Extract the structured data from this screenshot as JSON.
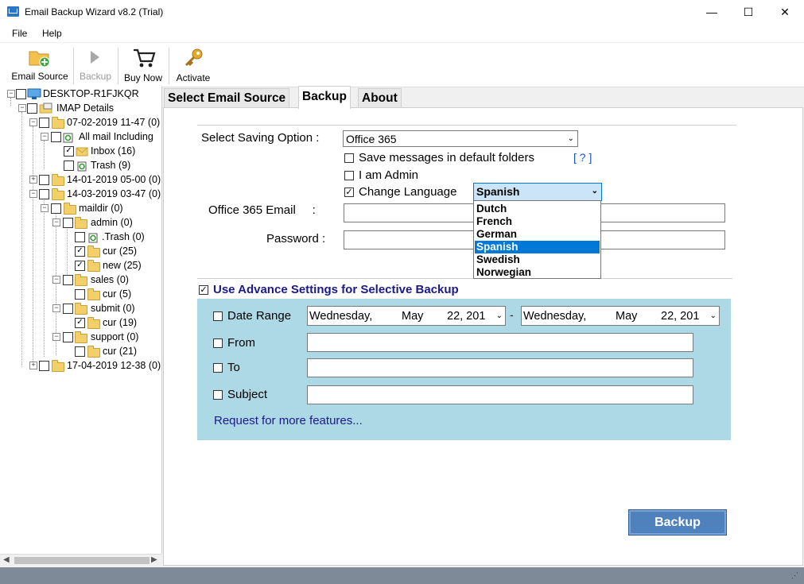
{
  "window": {
    "title": "Email Backup Wizard v8.2 (Trial)",
    "minimize": "—",
    "maximize": "☐",
    "close": "✕"
  },
  "menu": {
    "items": [
      "File",
      "Help"
    ]
  },
  "toolbar": {
    "email_source": "Email Source",
    "backup": "Backup",
    "buy_now": "Buy Now",
    "activate": "Activate"
  },
  "tree": {
    "root": "DESKTOP-R1FJKQR",
    "imap": "IMAP Details",
    "nodes": [
      "07-02-2019 11-47 (0)",
      "All mail Including",
      "Inbox (16)",
      "Trash (9)",
      "14-01-2019 05-00 (0)",
      "14-03-2019 03-47 (0)",
      "maildir (0)",
      "admin (0)",
      ".Trash (0)",
      "cur (25)",
      "new (25)",
      "sales (0)",
      "cur (5)",
      "submit (0)",
      "cur (19)",
      "support (0)",
      "cur (21)",
      "17-04-2019 12-38 (0)"
    ]
  },
  "tabs": [
    "Select Email Source",
    "Backup",
    "About"
  ],
  "backup": {
    "saving_label": "Select Saving Option :",
    "saving_value": "Office 365",
    "save_default": "Save messages in default folders",
    "help": "[ ? ]",
    "admin": "I am Admin",
    "change_language": "Change Language",
    "language_value": "Spanish",
    "languages": [
      "Dutch",
      "French",
      "German",
      "Spanish",
      "Swedish",
      "Norwegian"
    ],
    "email_label": "Office 365 Email     :",
    "password_label": "Password :",
    "advance": "Use Advance Settings for Selective Backup",
    "date_range": "Date Range",
    "date_from": {
      "day": "Wednesday,",
      "month": "May",
      "date": "22, 201"
    },
    "date_sep": "-",
    "date_to": {
      "day": "Wednesday,",
      "month": "May",
      "date": "22, 201"
    },
    "from": "From",
    "to": "To",
    "subject": "Subject",
    "request": "Request for more features...",
    "button": "Backup"
  },
  "colors": {
    "accent": "#4f81bd",
    "panel": "#add8e6",
    "link": "#1a1a8a",
    "selection": "#0078d7"
  }
}
